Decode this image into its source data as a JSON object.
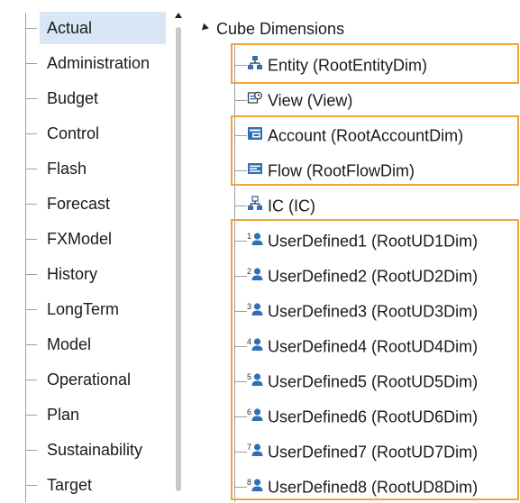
{
  "scenarios": [
    {
      "label": "Actual",
      "selected": true
    },
    {
      "label": "Administration"
    },
    {
      "label": "Budget"
    },
    {
      "label": "Control"
    },
    {
      "label": "Flash"
    },
    {
      "label": "Forecast"
    },
    {
      "label": "FXModel"
    },
    {
      "label": "History"
    },
    {
      "label": "LongTerm"
    },
    {
      "label": "Model"
    },
    {
      "label": "Operational"
    },
    {
      "label": "Plan"
    },
    {
      "label": "Sustainability"
    },
    {
      "label": "Target"
    }
  ],
  "tree": {
    "root_label": "Cube Dimensions",
    "dimensions": [
      {
        "label": "Entity  (RootEntityDim)",
        "icon": "entity-hierarchy-icon"
      },
      {
        "label": "View  (View)",
        "icon": "view-icon"
      },
      {
        "label": "Account  (RootAccountDim)",
        "icon": "account-icon"
      },
      {
        "label": "Flow  (RootFlowDim)",
        "icon": "flow-icon"
      },
      {
        "label": "IC  (IC)",
        "icon": "ic-hierarchy-icon"
      },
      {
        "label": "UserDefined1  (RootUD1Dim)",
        "icon": "user-defined-icon",
        "badge": "1"
      },
      {
        "label": "UserDefined2  (RootUD2Dim)",
        "icon": "user-defined-icon",
        "badge": "2"
      },
      {
        "label": "UserDefined3  (RootUD3Dim)",
        "icon": "user-defined-icon",
        "badge": "3"
      },
      {
        "label": "UserDefined4  (RootUD4Dim)",
        "icon": "user-defined-icon",
        "badge": "4"
      },
      {
        "label": "UserDefined5  (RootUD5Dim)",
        "icon": "user-defined-icon",
        "badge": "5"
      },
      {
        "label": "UserDefined6  (RootUD6Dim)",
        "icon": "user-defined-icon",
        "badge": "6"
      },
      {
        "label": "UserDefined7  (RootUD7Dim)",
        "icon": "user-defined-icon",
        "badge": "7"
      },
      {
        "label": "UserDefined8  (RootUD8Dim)",
        "icon": "user-defined-icon",
        "badge": "8"
      }
    ]
  },
  "colors": {
    "highlight": "#f0a43a",
    "selected_bg": "#d9e6f6",
    "icon_blue": "#2f6fb5",
    "icon_dark": "#333333"
  }
}
